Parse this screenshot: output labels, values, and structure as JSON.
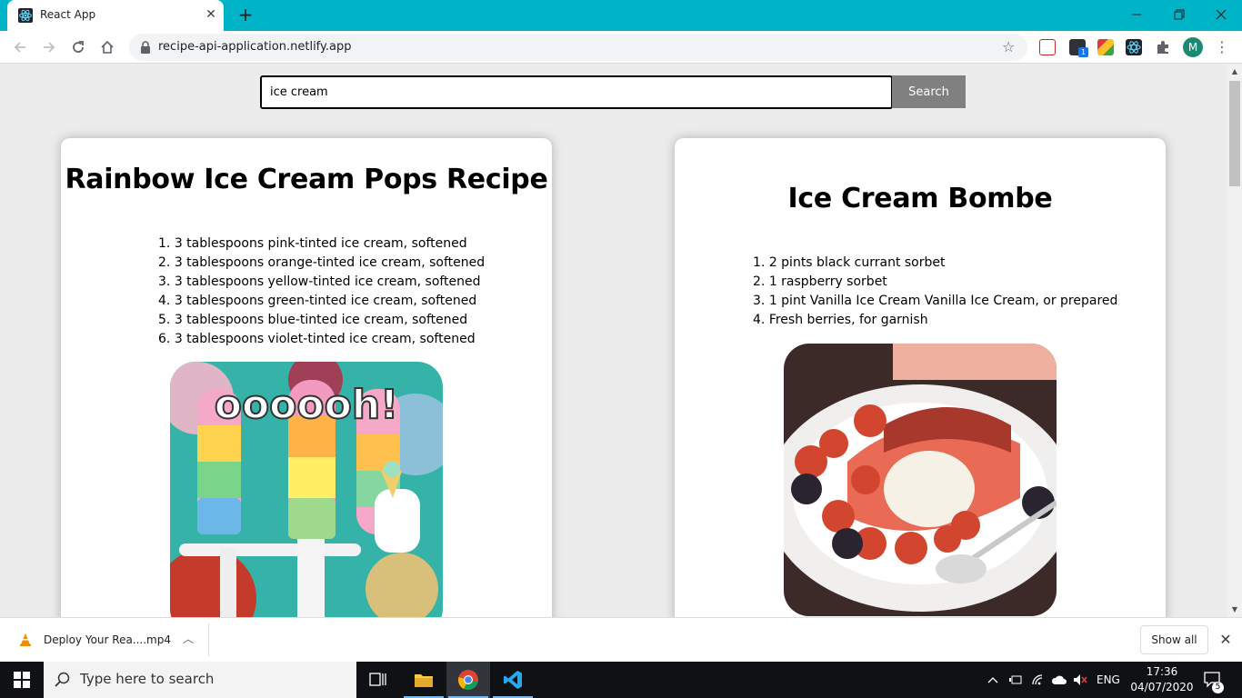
{
  "browser": {
    "tab_title": "React App",
    "tab_close": "✕",
    "new_tab": "+",
    "url": "recipe-api-application.netlify.app",
    "extension_badge": "1",
    "profile_initial": "M"
  },
  "search": {
    "value": "ice cream",
    "button_label": "Search"
  },
  "recipes": [
    {
      "title": "Rainbow Ice Cream Pops Recipe",
      "ingredients": [
        "3 tablespoons pink-tinted ice cream, softened",
        "3 tablespoons orange-tinted ice cream, softened",
        "3 tablespoons yellow-tinted ice cream, softened",
        "3 tablespoons green-tinted ice cream, softened",
        "3 tablespoons blue-tinted ice cream, softened",
        "3 tablespoons violet-tinted ice cream, softened"
      ],
      "image_caption": "oooooh!"
    },
    {
      "title": "Ice Cream Bombe",
      "ingredients": [
        "2 pints black currant sorbet",
        "1 raspberry sorbet",
        "1 pint Vanilla Ice Cream Vanilla Ice Cream, or prepared",
        "Fresh berries, for garnish"
      ]
    }
  ],
  "download_shelf": {
    "file_name": "Deploy Your Rea....mp4",
    "show_all_label": "Show all"
  },
  "taskbar": {
    "search_placeholder": "Type here to search",
    "language": "ENG",
    "time": "17:36",
    "date": "04/07/2020",
    "notification_count": "5"
  },
  "colors": {
    "titlebar": "#00b4c8",
    "search_button": "#808080",
    "page_bg": "#ececec"
  }
}
